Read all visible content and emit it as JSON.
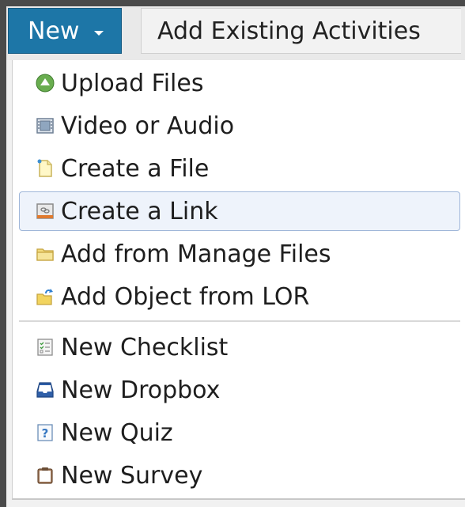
{
  "toolbar": {
    "new_label": "New",
    "existing_label": "Add Existing Activities"
  },
  "menu": {
    "items": [
      {
        "label": "Upload Files",
        "icon": "upload-icon"
      },
      {
        "label": "Video or Audio",
        "icon": "video-icon"
      },
      {
        "label": "Create a File",
        "icon": "new-file-icon"
      },
      {
        "label": "Create a Link",
        "icon": "link-icon",
        "highlighted": true
      },
      {
        "label": "Add from Manage Files",
        "icon": "folder-icon"
      },
      {
        "label": "Add Object from LOR",
        "icon": "lor-object-icon"
      },
      {
        "label": "New Checklist",
        "icon": "checklist-icon"
      },
      {
        "label": "New Dropbox",
        "icon": "dropbox-icon"
      },
      {
        "label": "New Quiz",
        "icon": "quiz-icon"
      },
      {
        "label": "New Survey",
        "icon": "survey-icon"
      }
    ]
  },
  "colors": {
    "new_button": "#1d76a7",
    "highlight_bg": "#eef3fb",
    "highlight_border": "#9fb6d9"
  }
}
